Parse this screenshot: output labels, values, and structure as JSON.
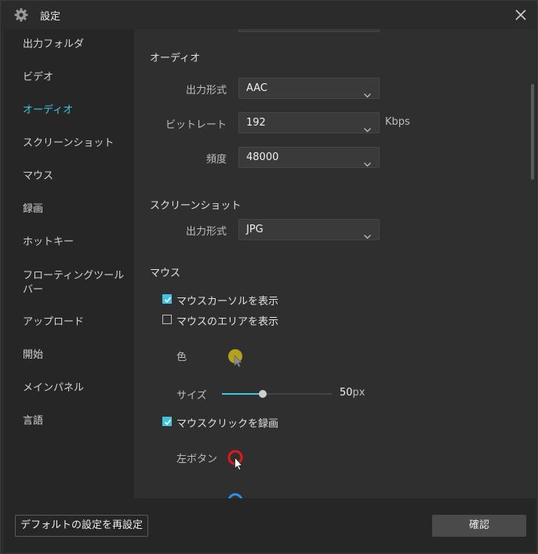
{
  "window": {
    "title": "設定",
    "icon": "gear-icon",
    "close_icon": "close-icon"
  },
  "sidebar": {
    "items": [
      {
        "label": "出力フォルダ",
        "active": false
      },
      {
        "label": "ビデオ",
        "active": false
      },
      {
        "label": "オーディオ",
        "active": true
      },
      {
        "label": "スクリーンショット",
        "active": false
      },
      {
        "label": "マウス",
        "active": false
      },
      {
        "label": "録画",
        "active": false
      },
      {
        "label": "ホットキー",
        "active": false
      },
      {
        "label": "フローティングツールバー",
        "active": false
      },
      {
        "label": "アップロード",
        "active": false
      },
      {
        "label": "開始",
        "active": false
      },
      {
        "label": "メインパネル",
        "active": false
      },
      {
        "label": "言語",
        "active": false
      }
    ],
    "float_toolbar_line1": "フローティングツール",
    "float_toolbar_line2": "バー"
  },
  "audio": {
    "section_title": "オーディオ",
    "format_label": "出力形式",
    "format_value": "AAC",
    "bitrate_label": "ビットレート",
    "bitrate_value": "192",
    "bitrate_unit": "Kbps",
    "frequency_label": "頻度",
    "frequency_value": "48000"
  },
  "screenshot": {
    "section_title": "スクリーンショット",
    "format_label": "出力形式",
    "format_value": "JPG"
  },
  "mouse": {
    "section_title": "マウス",
    "show_cursor_label": "マウスカーソルを表示",
    "show_cursor_checked": true,
    "show_area_label": "マウスのエリアを表示",
    "show_area_checked": false,
    "color_label": "色",
    "area_color": "#b3a21a",
    "size_label": "サイズ",
    "size_value": "50",
    "size_unit": "px",
    "size_fraction": 0.37,
    "record_click_label": "マウスクリックを録画",
    "record_click_checked": true,
    "left_button_label": "左ボタン",
    "left_click_color": "#e0191f",
    "right_click_color": "#2f8fe8"
  },
  "footer": {
    "reset_label": "デフォルトの設定を再設定",
    "ok_label": "確認"
  },
  "colors": {
    "accent": "#3ec6e0"
  }
}
